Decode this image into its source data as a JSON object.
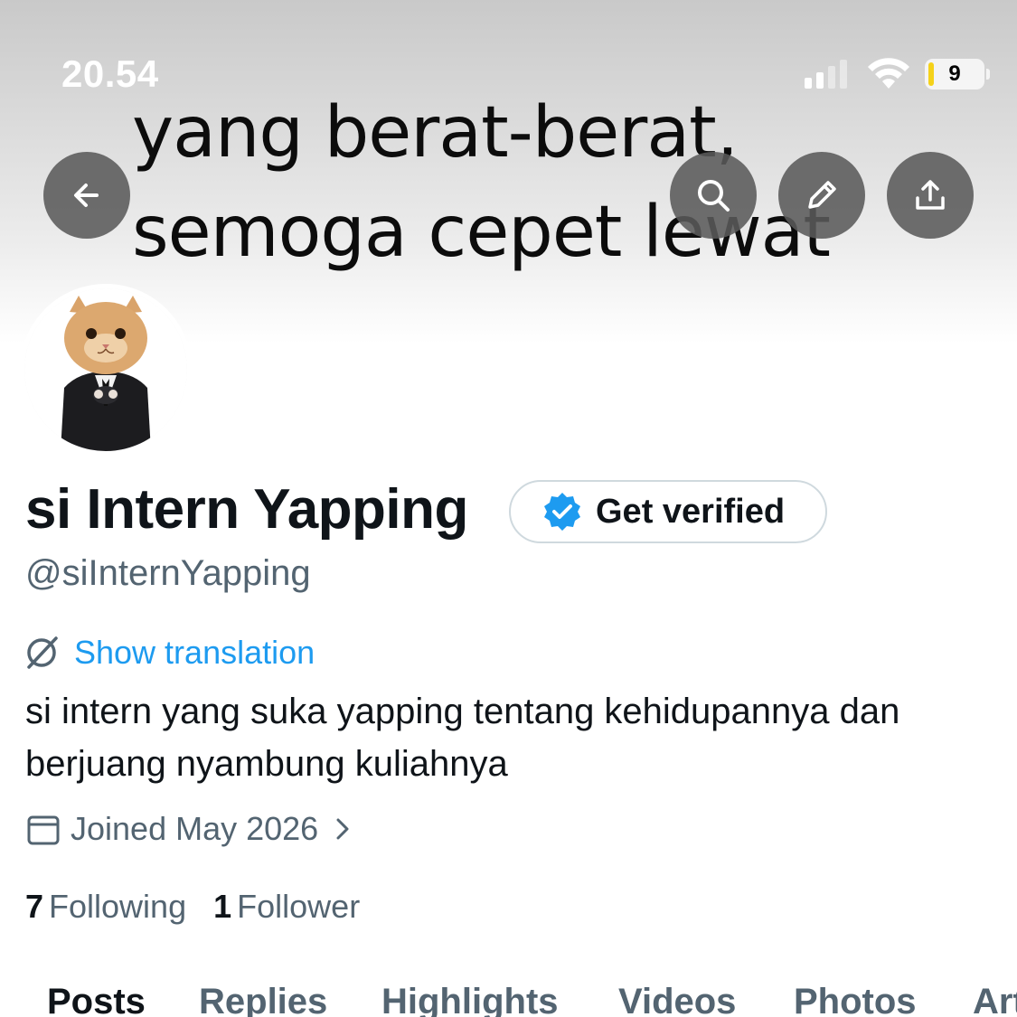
{
  "status_bar": {
    "time": "20.54",
    "battery_level": "9"
  },
  "banner": {
    "text": "yang berat-berat,\nsemoga cepet lewat"
  },
  "profile": {
    "display_name": "si Intern Yapping",
    "handle": "@siInternYapping",
    "verify_label": "Get verified",
    "show_translation_label": "Show translation",
    "bio": "si intern yang suka yapping tentang kehidupannya dan berjuang nyambung kuliahnya",
    "joined": "Joined May 2026",
    "following_count": "7",
    "following_label": "Following",
    "followers_count": "1",
    "followers_label": "Follower"
  },
  "tabs": [
    {
      "label": "Posts"
    },
    {
      "label": "Replies"
    },
    {
      "label": "Highlights"
    },
    {
      "label": "Videos"
    },
    {
      "label": "Photos"
    },
    {
      "label": "Articles"
    }
  ],
  "colors": {
    "accent": "#1d9bf0",
    "secondary_text": "#536471",
    "primary_text": "#0f1419"
  },
  "icons": {
    "back": "arrow-left-icon",
    "search": "search-icon",
    "edit": "pencil-icon",
    "share": "share-icon",
    "verified": "verified-badge-icon",
    "translate": "globe-translate-icon",
    "calendar": "calendar-icon",
    "chevron": "chevron-right-icon"
  }
}
